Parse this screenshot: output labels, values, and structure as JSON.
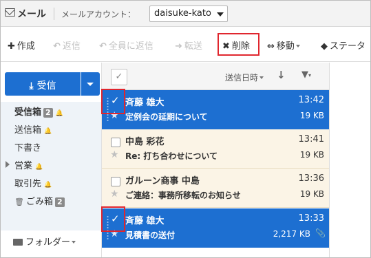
{
  "header": {
    "app_title": "メール",
    "account_label": "メールアカウント：",
    "account_value": "daisuke-kato"
  },
  "toolbar": {
    "create": "作成",
    "reply": "返信",
    "reply_all": "全員に返信",
    "forward": "転送",
    "delete": "削除",
    "move": "移動",
    "status": "ステータ"
  },
  "receive_button": "受信",
  "folders": [
    {
      "label": "受信箱",
      "badge": "2",
      "bell": true,
      "selected": true
    },
    {
      "label": "送信箱",
      "bell": true
    },
    {
      "label": "下書き"
    },
    {
      "label": "営業",
      "bell": true,
      "collapsible": true
    },
    {
      "label": "取引先",
      "bell": true
    },
    {
      "label": "ごみ箱",
      "badge": "2",
      "icon": "trash-icon"
    }
  ],
  "folder_menu": "フォルダー",
  "list": {
    "sort_label": "送信日時",
    "messages": [
      {
        "from": "斉藤 雄大",
        "time": "13:42",
        "subject": "定例会の延期について",
        "size": "19 KB",
        "selected": true
      },
      {
        "from": "中島 彩花",
        "time": "13:41",
        "subject": "Re: 打ち合わせについて",
        "size": "19 KB",
        "selected": false
      },
      {
        "from": "ガルーン商事 中島",
        "time": "13:36",
        "subject": "ご連絡：事務所移転のお知らせ",
        "size": "19 KB",
        "selected": false
      },
      {
        "from": "斉藤 雄大",
        "time": "13:33",
        "subject": "見積書の送付",
        "size": "2,217 KB",
        "selected": true,
        "attachment": true
      }
    ]
  },
  "colors": {
    "accent": "#1d6fd1",
    "highlight": "#e0262e",
    "unread_bg": "#fbf4e6"
  }
}
